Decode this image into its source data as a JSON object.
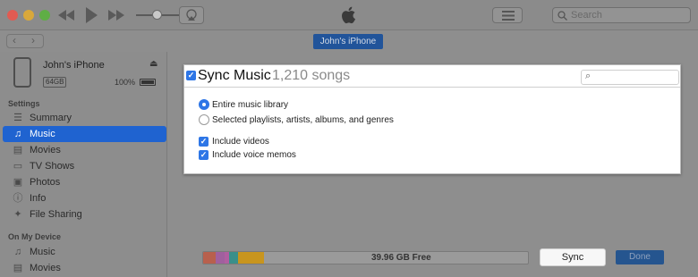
{
  "titlebar": {
    "search_placeholder": "Search",
    "icons": [
      "rewind-icon",
      "play-icon",
      "fast-forward-icon",
      "airplay-icon",
      "apple-logo-icon",
      "list-icon",
      "search-icon"
    ]
  },
  "nav": {
    "device_button": "John's iPhone"
  },
  "device": {
    "name": "John's iPhone",
    "capacity": "64GB",
    "battery": "100%"
  },
  "sidebar": {
    "settings_header": "Settings",
    "settings_items": [
      {
        "label": "Summary",
        "icon": "summary-icon"
      },
      {
        "label": "Music",
        "icon": "music-note-icon",
        "selected": true
      },
      {
        "label": "Movies",
        "icon": "film-icon"
      },
      {
        "label": "TV Shows",
        "icon": "tv-icon"
      },
      {
        "label": "Photos",
        "icon": "camera-icon"
      },
      {
        "label": "Info",
        "icon": "info-icon"
      },
      {
        "label": "File Sharing",
        "icon": "file-sharing-icon"
      }
    ],
    "device_header": "On My Device",
    "device_items": [
      {
        "label": "Music",
        "icon": "music-note-icon"
      },
      {
        "label": "Movies",
        "icon": "film-icon"
      }
    ]
  },
  "panel": {
    "title": "Sync Music",
    "count": "1,210 songs",
    "title_checked": true,
    "options": [
      {
        "label": "Entire music library",
        "selected": true
      },
      {
        "label": "Selected playlists, artists, albums, and genres",
        "selected": false
      }
    ],
    "checkboxes": [
      {
        "label": "Include videos",
        "checked": true
      },
      {
        "label": "Include voice memos",
        "checked": true
      }
    ]
  },
  "footer": {
    "free_space": "39.96 GB Free",
    "sync_label": "Sync",
    "done_label": "Done"
  },
  "colors": {
    "accent": "#1f63d0",
    "storage_segments": [
      "#b8604d",
      "#a0609e",
      "#b05fa0",
      "#3a8f8a",
      "#c8951e"
    ]
  }
}
